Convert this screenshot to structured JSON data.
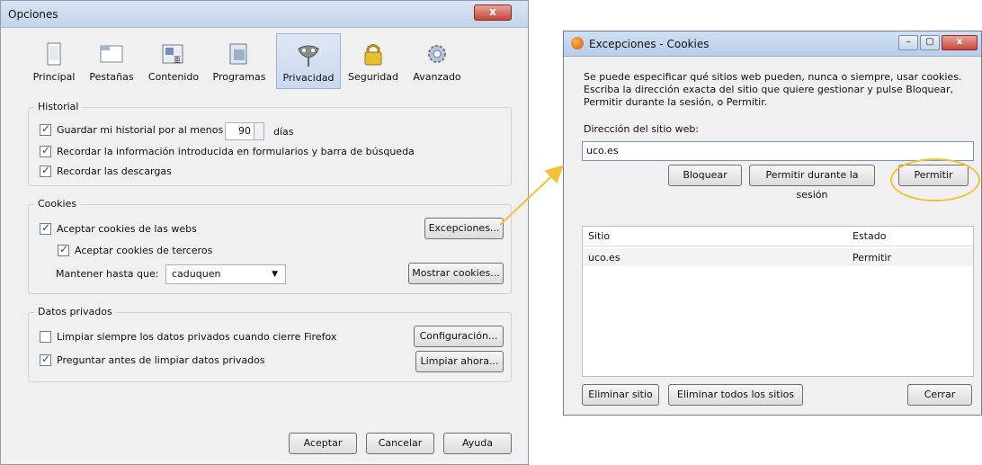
{
  "options": {
    "title": "Opciones",
    "tabs": [
      "Principal",
      "Pestañas",
      "Contenido",
      "Programas",
      "Privacidad",
      "Seguridad",
      "Avanzado"
    ],
    "historial": {
      "legend": "Historial",
      "guardar_pre": "Guardar mi historial por al menos",
      "days_value": "90",
      "dias": "días",
      "recordar_info": "Recordar la información introducida en formularios y barra de búsqueda",
      "recordar_descargas": "Recordar las descargas"
    },
    "cookies": {
      "legend": "Cookies",
      "aceptar_webs": "Aceptar cookies de las webs",
      "aceptar_terceros": "Aceptar cookies de terceros",
      "mantener": "Mantener hasta que:",
      "mantener_value": "caduquen",
      "excepciones_btn": "Excepciones...",
      "mostrar_btn": "Mostrar cookies..."
    },
    "datos": {
      "legend": "Datos privados",
      "limpiar_siempre": "Limpiar siempre los datos privados cuando cierre Firefox",
      "preguntar": "Preguntar antes de limpiar datos privados",
      "configuracion_btn": "Configuración...",
      "limpiar_ahora_btn": "Limpiar ahora..."
    },
    "buttons": {
      "aceptar": "Aceptar",
      "cancelar": "Cancelar",
      "ayuda": "Ayuda"
    }
  },
  "exceptions": {
    "title": "Excepciones - Cookies",
    "desc1": "Se puede especificar qué sitios web pueden, nunca o siempre, usar cookies.",
    "desc2": "Escriba la dirección exacta del sitio que quiere gestionar y pulse Bloquear,",
    "desc3": "Permitir durante la sesión, o Permitir.",
    "address_label": "Dirección del sitio web:",
    "address_value": "uco.es",
    "bloquear": "Bloquear",
    "permitir_sesion": "Permitir durante la sesión",
    "permitir": "Permitir",
    "columns": {
      "sitio": "Sitio",
      "estado": "Estado"
    },
    "rows": [
      {
        "sitio": "uco.es",
        "estado": "Permitir"
      }
    ],
    "eliminar_sitio": "Eliminar sitio",
    "eliminar_todos": "Eliminar todos los sitios",
    "cerrar": "Cerrar"
  },
  "colors": {
    "highlight_ring": "#f1c33a"
  }
}
